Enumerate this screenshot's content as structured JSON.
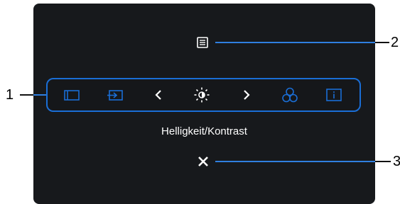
{
  "osd": {
    "toolbar_items": [
      {
        "icon": "window-icon"
      },
      {
        "icon": "input-source-icon"
      },
      {
        "icon": "chevron-left-icon"
      },
      {
        "icon": "brightness-contrast-icon"
      },
      {
        "icon": "chevron-right-icon"
      },
      {
        "icon": "color-settings-icon"
      },
      {
        "icon": "info-icon"
      }
    ],
    "selected_label": "Helligkeit/Kontrast",
    "accent_color": "#1a6ed6"
  },
  "callouts": {
    "toolbar": "1",
    "menu": "2",
    "close": "3"
  }
}
